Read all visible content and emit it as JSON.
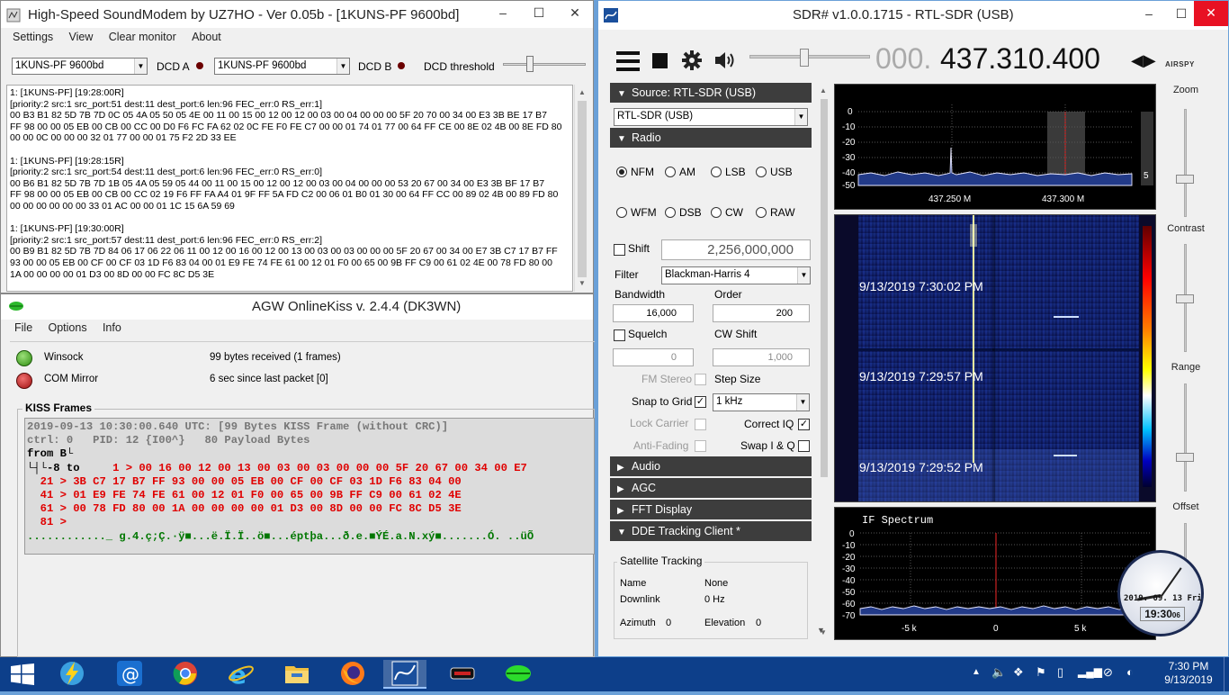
{
  "soundmodem": {
    "title": "High-Speed SoundModem by UZ7HO - Ver 0.05b - [1KUNS-PF 9600bd]",
    "menu": [
      "Settings",
      "View",
      "Clear monitor",
      "About"
    ],
    "modem_a": "1KUNS-PF 9600bd",
    "dcd_a_label": "DCD A",
    "modem_b": "1KUNS-PF 9600bd",
    "dcd_b_label": "DCD B",
    "dcd_threshold_label": "DCD threshold",
    "monitor_lines": [
      "1: [1KUNS-PF] [19:28:00R]",
      "[priority:2 src:1 src_port:51 dest:11 dest_port:6 len:96 FEC_err:0 RS_err:1]",
      "00 B3 B1 82 5D 7B 7D 0C 05 4A 05 50 05 4E 00 11 00 15 00 12 00 12 00 03 00 04 00 00 00 5F 20 70 00 34 00 E3 3B BE 17 B7",
      "FF 98 00 00 05 EB 00 CB 00 CC 00 D0 F6 FC FA 62 02 0C FE F0 FE C7 00 00 01 74 01 77 00 64 FF CE 00 8E 02 4B 00 8E FD 80",
      "00 00 0C 00 00 00 32 01 77 00 00 01 75 F2 2D 33 EE",
      "",
      "1: [1KUNS-PF] [19:28:15R]",
      "[priority:2 src:1 src_port:54 dest:11 dest_port:6 len:96 FEC_err:0 RS_err:0]",
      "00 B6 B1 82 5D 7B 7D 1B 05 4A 05 59 05 44 00 11 00 15 00 12 00 12 00 03 00 04 00 00 00 53 20 67 00 34 00 E3 3B BF 17 B7",
      "FF 98 00 00 05 EB 00 CB 00 CC 02 19 F6 FF FA A4 01 9F FF 5A FD C2 00 06 01 B0 01 30 00 64 FF CC 00 89 02 4B 00 89 FD 80",
      "00 00 00 00 00 00 33 01 AC 00 00 01 1C 15 6A 59 69",
      "",
      "1: [1KUNS-PF] [19:30:00R]",
      "[priority:2 src:1 src_port:57 dest:11 dest_port:6 len:96 FEC_err:0 RS_err:2]",
      "00 B9 B1 82 5D 7B 7D 84 06 17 06 22 06 11 00 12 00 16 00 12 00 13 00 03 00 03 00 00 00 5F 20 67 00 34 00 E7 3B C7 17 B7 FF",
      "93 00 00 05 EB 00 CF 00 CF 03 1D F6 83 04 00 01 E9 FE 74 FE 61 00 12 01 F0 00 65 00 9B FF C9 00 61 02 4E 00 78 FD 80 00",
      "1A 00 00 00 00 01 D3 00 8D 00 00 FC 8C D5 3E"
    ]
  },
  "agw": {
    "title": "AGW OnlineKiss v. 2.4.4  (DK3WN)",
    "menu": [
      "File",
      "Options",
      "Info"
    ],
    "winsock_label": "Winsock",
    "com_label": "COM Mirror",
    "bytes_received": "99 bytes received (1 frames)",
    "since_last": "6 sec since last packet [0]",
    "frames_title": "KISS Frames",
    "kiss_header": "2019-09-13 10:30:00.640 UTC: [99 Bytes KISS Frame (without CRC)]",
    "kiss_ctrl": "ctrl: 0   PID: 12 {I00^}   80 Payload Bytes",
    "kiss_from": "from B└",
    "kiss_to": "└┤└-8 to",
    "kiss_hex": [
      "     1 > 00 16 00 12 00 13 00 03 00 03 00 00 00 5F 20 67 00 34 00 E7",
      "  21 > 3B C7 17 B7 FF 93 00 00 05 EB 00 CF 00 CF 03 1D F6 83 04 00",
      "  41 > 01 E9 FE 74 FE 61 00 12 01 F0 00 65 00 9B FF C9 00 61 02 4E",
      "  61 > 00 78 FD 80 00 1A 00 00 00 00 01 D3 00 8D 00 00 FC 8C D5 3E",
      "  81 >"
    ],
    "kiss_ascii": "............_ g.4.ç;Ç.·ÿ■...ë.Ï.Ï..ö■...éptþa...ð.e.■ÝÉ.a.N.xý■.......Ó. ..üÕ"
  },
  "sdr": {
    "title": "SDR# v1.0.0.1715 - RTL-SDR (USB)",
    "freq_dim": "000.",
    "freq_main": "437.310.400",
    "logo_text": "AIRSPY",
    "source_header": "Source: RTL-SDR (USB)",
    "source_select": "RTL-SDR (USB)",
    "radio_header": "Radio",
    "modes_row1": [
      "NFM",
      "AM",
      "LSB",
      "USB"
    ],
    "modes_row2": [
      "WFM",
      "DSB",
      "CW",
      "RAW"
    ],
    "selected_mode": "NFM",
    "shift_label": "Shift",
    "shift_value": "2,256,000,000",
    "filter_label": "Filter",
    "filter_value": "Blackman-Harris 4",
    "bandwidth_label": "Bandwidth",
    "bandwidth_value": "16,000",
    "order_label": "Order",
    "order_value": "200",
    "squelch_label": "Squelch",
    "cw_shift_label": "CW Shift",
    "squelch_value": "0",
    "cw_shift_value": "1,000",
    "fm_stereo_label": "FM Stereo",
    "step_size_label": "Step Size",
    "snap_label": "Snap to Grid",
    "step_value": "1 kHz",
    "lock_carrier_label": "Lock Carrier",
    "correct_iq_label": "Correct IQ",
    "anti_fading_label": "Anti-Fading",
    "swap_iq_label": "Swap I & Q",
    "collapsed_panels": [
      "Audio",
      "AGC",
      "FFT Display"
    ],
    "dde_header": "DDE Tracking Client *",
    "sat_title": "Satellite Tracking",
    "name_label": "Name",
    "name_value": "None",
    "downlink_label": "Downlink",
    "downlink_value": "0 Hz",
    "azimuth_label": "Azimuth",
    "azimuth_value": "0",
    "elevation_label": "Elevation",
    "elevation_value": "0",
    "zoom_label": "Zoom",
    "contrast_label": "Contrast",
    "range_label": "Range",
    "offset_label": "Offset",
    "spectrum_yticks": [
      "0",
      "-10",
      "-20",
      "-30",
      "-40",
      "-50"
    ],
    "spectrum_xticks": [
      "437.250 M",
      "437.300 M"
    ],
    "spectrum_side_value": "5",
    "waterfall_times": [
      "9/13/2019 7:30:02 PM",
      "9/13/2019 7:29:57 PM",
      "9/13/2019 7:29:52 PM"
    ],
    "if_title": "IF Spectrum",
    "if_yticks": [
      "0",
      "-10",
      "-20",
      "-30",
      "-40",
      "-50",
      "-60",
      "-70"
    ],
    "if_xticks": [
      "-5 k",
      "0",
      "5 k"
    ],
    "clock_date": "2019. 09. 13 Fri",
    "clock_time": "19:30",
    "clock_sec": "06"
  },
  "taskbar": {
    "time": "7:30 PM",
    "date": "9/13/2019"
  },
  "colors": {
    "taskbar": "#0d3f8a",
    "close_red": "#e81123",
    "kiss_red": "#e00000",
    "marker_red": "#cc2222"
  }
}
